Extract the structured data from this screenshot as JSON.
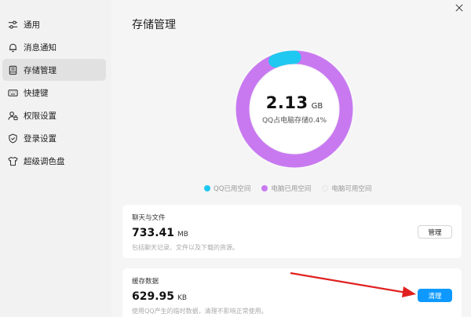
{
  "sidebar": {
    "items": [
      {
        "label": "通用",
        "icon": "sliders-icon",
        "active": false
      },
      {
        "label": "消息通知",
        "icon": "bell-icon",
        "active": false
      },
      {
        "label": "存储管理",
        "icon": "storage-icon",
        "active": true
      },
      {
        "label": "快捷键",
        "icon": "keyboard-icon",
        "active": false
      },
      {
        "label": "权限设置",
        "icon": "user-lock-icon",
        "active": false
      },
      {
        "label": "登录设置",
        "icon": "shield-icon",
        "active": false
      },
      {
        "label": "超级调色盘",
        "icon": "shirt-icon",
        "active": false
      }
    ]
  },
  "page": {
    "title": "存储管理"
  },
  "storage": {
    "value": "2.13",
    "unit": "GB",
    "subtitle": "QQ占电脑存储0.4%",
    "qq_fraction": 0.06
  },
  "legend": [
    {
      "label": "QQ已用空间",
      "color": "#1ec8f0"
    },
    {
      "label": "电脑已用空间",
      "color": "#c879f0"
    },
    {
      "label": "电脑可用空间",
      "color": "#f4f4f4"
    }
  ],
  "cards": {
    "chat": {
      "title": "聊天与文件",
      "value": "733.41",
      "unit": "MB",
      "desc": "包括聊天记录、文件以及下载的资源。",
      "button": "管理"
    },
    "cache": {
      "title": "缓存数据",
      "value": "629.95",
      "unit": "KB",
      "desc": "使用QQ产生的临时数据，清理不影响正常使用。",
      "button": "清理"
    }
  },
  "colors": {
    "qq_used": "#1ec8f0",
    "pc_used": "#c879f0",
    "primary": "#0d99ff",
    "arrow": "#e02020"
  }
}
